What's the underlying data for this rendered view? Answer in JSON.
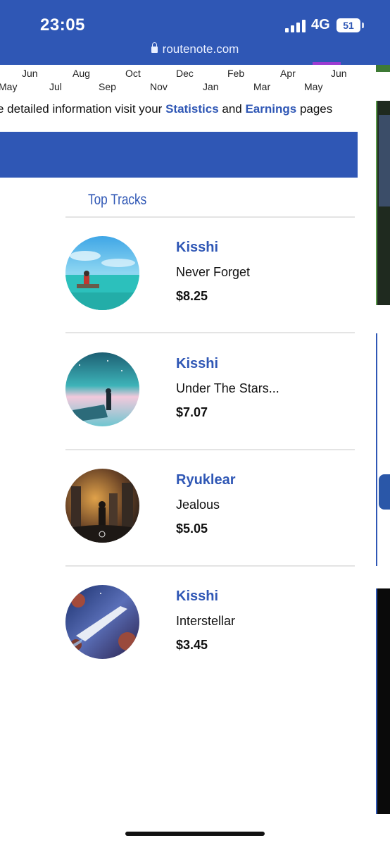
{
  "status_bar": {
    "time": "23:05",
    "network": "4G",
    "battery": "51"
  },
  "browser": {
    "url": "routenote.com"
  },
  "chart_axis": {
    "top_row": [
      "Jun",
      "Aug",
      "Oct",
      "Dec",
      "Feb",
      "Apr",
      "Jun"
    ],
    "bottom_row": [
      "May",
      "Jul",
      "Sep",
      "Nov",
      "Jan",
      "Mar",
      "May"
    ]
  },
  "info": {
    "prefix": "e detailed information visit your ",
    "statistics_link": "Statistics",
    "middle": " and ",
    "earnings_link": "Earnings",
    "suffix": " pages"
  },
  "top_tracks": {
    "heading": "Top Tracks",
    "items": [
      {
        "artist": "Kisshi",
        "title": "Never Forget",
        "amount": "$8.25"
      },
      {
        "artist": "Kisshi",
        "title": "Under The Stars...",
        "amount": "$7.07"
      },
      {
        "artist": "Ryuklear",
        "title": "Jealous",
        "amount": "$5.05"
      },
      {
        "artist": "Kisshi",
        "title": "Interstellar",
        "amount": "$3.45"
      }
    ]
  },
  "colors": {
    "brand_blue": "#2f57b5",
    "link_blue": "#2f57b5"
  }
}
